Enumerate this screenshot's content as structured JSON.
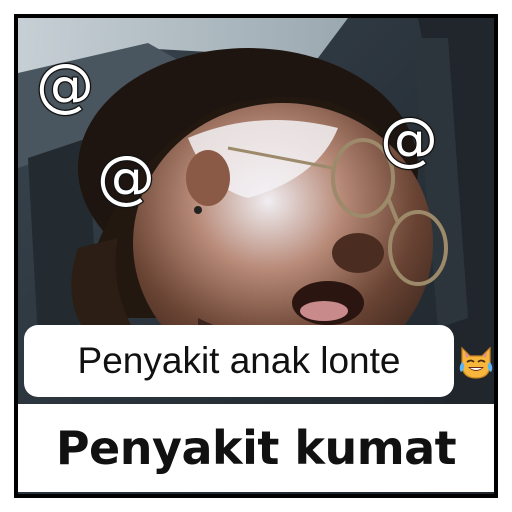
{
  "overlay_symbols": [
    "@",
    "@",
    "@"
  ],
  "caption_top": "Penyakit anak lonte",
  "caption_bottom": "Penyakit kumat",
  "emoji": "cat-tears-of-joy-icon",
  "colors": {
    "border": "#000000",
    "caption_bg": "#ffffff",
    "caption_text": "#111111",
    "symbol_fill": "#ffffff",
    "symbol_stroke": "#1a1a1a"
  }
}
